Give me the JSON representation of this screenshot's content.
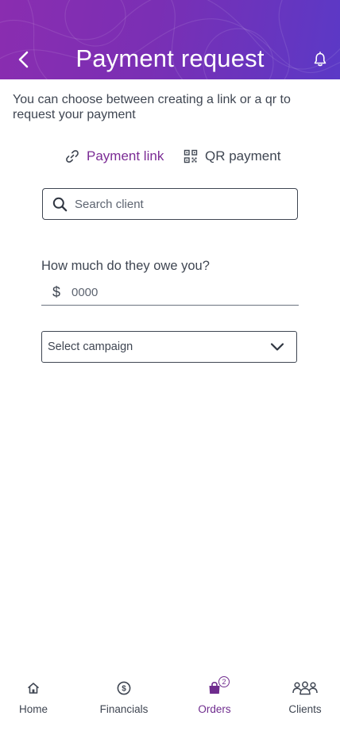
{
  "header": {
    "title": "Payment request",
    "back_icon": "chevron-left-icon",
    "notification_icon": "bell-icon",
    "gradient_colors": [
      "#8a2db0",
      "#5b39c6"
    ]
  },
  "intro": {
    "text": "You can choose between creating a link or a qr to request your payment"
  },
  "tabs": [
    {
      "label": "Payment link",
      "icon": "link-icon",
      "active": true,
      "color": "#7b2c95"
    },
    {
      "label": "QR payment",
      "icon": "qr-code-icon",
      "active": false
    }
  ],
  "search": {
    "placeholder": "Search client",
    "value": ""
  },
  "amount": {
    "label": "How much do they owe you?",
    "currency": "$",
    "placeholder": "0000",
    "value": ""
  },
  "campaign": {
    "selected": "Select campaign"
  },
  "bottom_nav": {
    "items": [
      {
        "label": "Home",
        "icon": "home-icon",
        "active": false
      },
      {
        "label": "Financials",
        "icon": "dollar-circle-icon",
        "active": false
      },
      {
        "label": "Orders",
        "icon": "shopping-bag-icon",
        "active": true,
        "badge": "2"
      },
      {
        "label": "Clients",
        "icon": "users-icon",
        "active": false
      }
    ],
    "active_color": "#6f2c8e"
  }
}
